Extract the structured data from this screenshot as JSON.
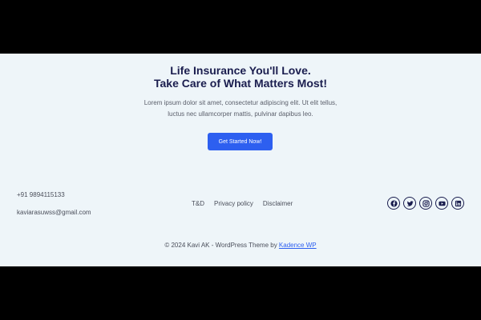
{
  "hero": {
    "title_line1": "Life Insurance You'll Love.",
    "title_line2": "Take Care of What Matters Most!",
    "text_line1": "Lorem ipsum dolor sit amet, consectetur adipiscing elit. Ut elit tellus,",
    "text_line2": "luctus nec ullamcorper mattis, pulvinar dapibus leo.",
    "cta_label": "Get Started Now!"
  },
  "contact": {
    "phone": "+91 9894115133",
    "email": "kaviarasuwss@gmail.com"
  },
  "footer_links": [
    "T&D",
    "Privacy policy",
    "Disclaimer"
  ],
  "socials": [
    "facebook-icon",
    "twitter-icon",
    "instagram-icon",
    "youtube-icon",
    "linkedin-icon"
  ],
  "copyright": {
    "text": "© 2024 Kavi AK - WordPress Theme by ",
    "link": "Kadence WP"
  },
  "colors": {
    "background": "#eef5f9",
    "heading": "#1a1d4e",
    "accent": "#2d5ff0"
  }
}
